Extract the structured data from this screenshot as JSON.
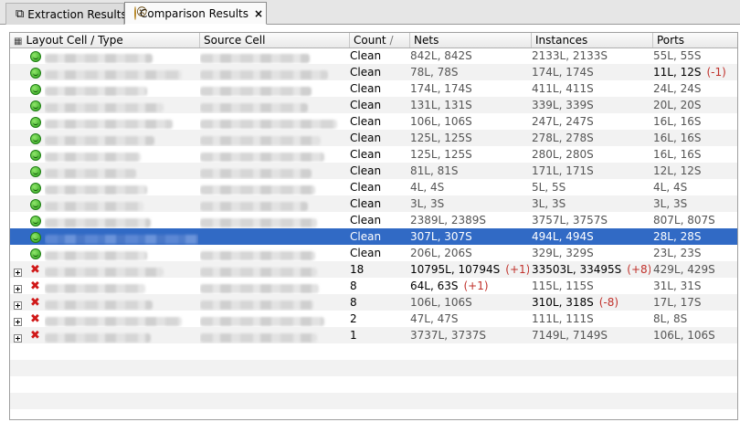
{
  "tabs": [
    {
      "label": "Extraction Results",
      "icon": "extraction-icon",
      "active": false
    },
    {
      "label": "Comparison Results",
      "icon": "sad-face-icon",
      "active": true,
      "close": "×"
    }
  ],
  "table": {
    "columns": [
      "Layout Cell / Type",
      "Source Cell",
      "Count",
      "Nets",
      "Instances",
      "Ports"
    ],
    "sort_indicator": "/",
    "rows": [
      {
        "status": "ok",
        "expandable": false,
        "count": "Clean",
        "nets": "842L, 842S",
        "nets_delta": "",
        "inst": "2133L, 2133S",
        "inst_delta": "",
        "ports": "55L, 55S",
        "ports_delta": ""
      },
      {
        "status": "ok",
        "expandable": false,
        "count": "Clean",
        "nets": "78L, 78S",
        "nets_delta": "",
        "inst": "174L, 174S",
        "inst_delta": "",
        "ports": "11L, 12S",
        "ports_delta": "(-1)"
      },
      {
        "status": "ok",
        "expandable": false,
        "count": "Clean",
        "nets": "174L, 174S",
        "nets_delta": "",
        "inst": "411L, 411S",
        "inst_delta": "",
        "ports": "24L, 24S",
        "ports_delta": ""
      },
      {
        "status": "ok",
        "expandable": false,
        "count": "Clean",
        "nets": "131L, 131S",
        "nets_delta": "",
        "inst": "339L, 339S",
        "inst_delta": "",
        "ports": "20L, 20S",
        "ports_delta": ""
      },
      {
        "status": "ok",
        "expandable": false,
        "count": "Clean",
        "nets": "106L, 106S",
        "nets_delta": "",
        "inst": "247L, 247S",
        "inst_delta": "",
        "ports": "16L, 16S",
        "ports_delta": ""
      },
      {
        "status": "ok",
        "expandable": false,
        "count": "Clean",
        "nets": "125L, 125S",
        "nets_delta": "",
        "inst": "278L, 278S",
        "inst_delta": "",
        "ports": "16L, 16S",
        "ports_delta": ""
      },
      {
        "status": "ok",
        "expandable": false,
        "count": "Clean",
        "nets": "125L, 125S",
        "nets_delta": "",
        "inst": "280L, 280S",
        "inst_delta": "",
        "ports": "16L, 16S",
        "ports_delta": ""
      },
      {
        "status": "ok",
        "expandable": false,
        "count": "Clean",
        "nets": "81L, 81S",
        "nets_delta": "",
        "inst": "171L, 171S",
        "inst_delta": "",
        "ports": "12L, 12S",
        "ports_delta": ""
      },
      {
        "status": "ok",
        "expandable": false,
        "count": "Clean",
        "nets": "4L, 4S",
        "nets_delta": "",
        "inst": "5L, 5S",
        "inst_delta": "",
        "ports": "4L, 4S",
        "ports_delta": ""
      },
      {
        "status": "ok",
        "expandable": false,
        "count": "Clean",
        "nets": "3L, 3S",
        "nets_delta": "",
        "inst": "3L, 3S",
        "inst_delta": "",
        "ports": "3L, 3S",
        "ports_delta": ""
      },
      {
        "status": "ok",
        "expandable": false,
        "count": "Clean",
        "nets": "2389L, 2389S",
        "nets_delta": "",
        "inst": "3757L, 3757S",
        "inst_delta": "",
        "ports": "807L, 807S",
        "ports_delta": ""
      },
      {
        "status": "ok",
        "expandable": false,
        "selected": true,
        "count": "Clean",
        "nets": "307L, 307S",
        "nets_delta": "",
        "inst": "494L, 494S",
        "inst_delta": "",
        "ports": "28L, 28S",
        "ports_delta": ""
      },
      {
        "status": "ok",
        "expandable": false,
        "count": "Clean",
        "nets": "206L, 206S",
        "nets_delta": "",
        "inst": "329L, 329S",
        "inst_delta": "",
        "ports": "23L, 23S",
        "ports_delta": ""
      },
      {
        "status": "bad",
        "expandable": true,
        "count": "18",
        "nets": "10795L, 10794S",
        "nets_delta": "(+1)",
        "inst": "33503L, 33495S",
        "inst_delta": "(+8)",
        "ports": "429L, 429S",
        "ports_delta": ""
      },
      {
        "status": "bad",
        "expandable": true,
        "count": "8",
        "nets": "64L, 63S",
        "nets_delta": "(+1)",
        "inst": "115L, 115S",
        "inst_delta": "",
        "ports": "31L, 31S",
        "ports_delta": ""
      },
      {
        "status": "bad",
        "expandable": true,
        "count": "8",
        "nets": "106L, 106S",
        "nets_delta": "",
        "inst": "310L, 318S",
        "inst_delta": "(-8)",
        "ports": "17L, 17S",
        "ports_delta": ""
      },
      {
        "status": "bad",
        "expandable": true,
        "count": "2",
        "nets": "47L, 47S",
        "nets_delta": "",
        "inst": "111L, 111S",
        "inst_delta": "",
        "ports": "8L, 8S",
        "ports_delta": ""
      },
      {
        "status": "bad",
        "expandable": true,
        "count": "1",
        "nets": "3737L, 3737S",
        "nets_delta": "",
        "inst": "7149L, 7149S",
        "inst_delta": "",
        "ports": "106L, 106S",
        "ports_delta": ""
      }
    ],
    "empty_rows": 5
  },
  "colors": {
    "selection": "#316ac5",
    "delta": "#c0302a",
    "fail": "#d01818",
    "pass": "#2fa51e"
  }
}
